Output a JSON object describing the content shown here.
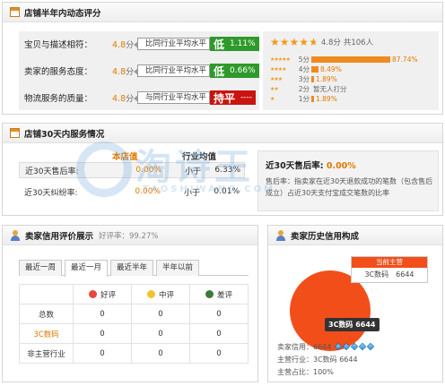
{
  "panel1": {
    "title": "店铺半年内动态评分",
    "rows": [
      {
        "label": "宝贝与描述相符：",
        "score": "4.8",
        "unit": "分",
        "cmp_text": "比同行业平均水平",
        "badge_word": "低",
        "badge_value": "1.11%",
        "badge_color": "#2f9a2b"
      },
      {
        "label": "卖家的服务态度：",
        "score": "4.8",
        "unit": "分",
        "cmp_text": "比同行业平均水平",
        "badge_word": "低",
        "badge_value": "0.66%",
        "badge_color": "#2f9a2b"
      },
      {
        "label": "物流服务的质量：",
        "score": "4.8",
        "unit": "分",
        "cmp_text": "与同行业平均水平",
        "badge_word": "持平",
        "badge_value": "----",
        "badge_color": "#c9140f"
      }
    ],
    "summary": {
      "score_text": "4.8分",
      "count_text": "共106人",
      "stars": 4.8
    },
    "distribution": [
      {
        "stars": 5,
        "label": "5分",
        "pct": "87.74%",
        "fraction": 0.8774
      },
      {
        "stars": 4,
        "label": "4分",
        "pct": "8.49%",
        "fraction": 0.0849
      },
      {
        "stars": 3,
        "label": "3分",
        "pct": "1.89%",
        "fraction": 0.0189
      },
      {
        "stars": 2,
        "label": "2分",
        "pct": "暂无人打分",
        "fraction": 0
      },
      {
        "stars": 1,
        "label": "1分",
        "pct": "1.89%",
        "fraction": 0.0189
      }
    ]
  },
  "panel2": {
    "title": "店铺30天内服务情况",
    "col_shop": "本店值",
    "col_industry": "行业均值",
    "rows": [
      {
        "label": "近30天售后率:",
        "shop": "0.00%",
        "cmp": "小于",
        "industry": "6.33%"
      },
      {
        "label": "近30天纠纷率:",
        "shop": "0.00%",
        "cmp": "小于",
        "industry": "0.01%"
      }
    ],
    "desc_title": "近30天售后率:",
    "desc_value": "0.00%",
    "desc_text": "售后率：指卖家在近30天退款成功的笔数（包含售后成立）占近30天支付宝成交笔数的比率"
  },
  "watermark": {
    "big": "淘诗王",
    "small": "TAOSHIWANG.COM"
  },
  "panel3": {
    "title": "卖家信用评价展示",
    "good_rate": "好评率：99.27%",
    "tabs": [
      "最近一周",
      "最近一月",
      "最近半年",
      "半年以前"
    ],
    "active_tab": 1,
    "headers": [
      "好评",
      "中评",
      "差评"
    ],
    "rows": [
      {
        "label": "总数",
        "values": [
          "0",
          "0",
          "0"
        ],
        "highlight": false
      },
      {
        "label": "3C数码",
        "values": [
          "0",
          "0",
          "0"
        ],
        "highlight": true
      },
      {
        "label": "非主营行业",
        "values": [
          "0",
          "0",
          "0"
        ],
        "highlight": false
      }
    ]
  },
  "panel4": {
    "title": "卖家历史信用构成",
    "current_label": "当前主营",
    "current_value": "3C数码　6644",
    "tooltip": "3C数码 6644",
    "credit_label": "卖家信用：",
    "credit_value": "6644",
    "main_label": "主营行业：",
    "main_value": "3C数码 6644",
    "share_label": "主营占比：",
    "share_value": "100%",
    "share_fraction": 1.0,
    "pie_color": "#f24e1a"
  }
}
